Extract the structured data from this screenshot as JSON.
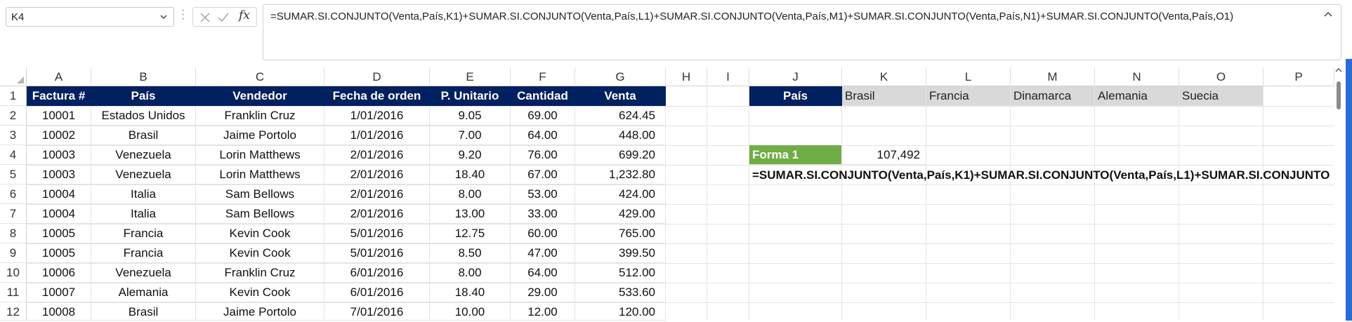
{
  "formula_bar": {
    "name_box": "K4",
    "fx_label": "fx",
    "formula": "=SUMAR.SI.CONJUNTO(Venta,País,K1)+SUMAR.SI.CONJUNTO(Venta,País,L1)+SUMAR.SI.CONJUNTO(Venta,País,M1)+SUMAR.SI.CONJUNTO(Venta,País,N1)+SUMAR.SI.CONJUNTO(Venta,País,O1)"
  },
  "columns": [
    "A",
    "B",
    "C",
    "D",
    "E",
    "F",
    "G",
    "H",
    "I",
    "J",
    "K",
    "L",
    "M",
    "N",
    "O",
    "P"
  ],
  "row_numbers": [
    "1",
    "2",
    "3",
    "4",
    "5",
    "6",
    "7",
    "8",
    "9",
    "10",
    "11",
    "12"
  ],
  "table": {
    "headers": [
      "Factura #",
      "País",
      "Vendedor",
      "Fecha de orden",
      "P. Unitario",
      "Cantidad",
      "Venta"
    ],
    "rows": [
      [
        "10001",
        "Estados Unidos",
        "Franklin Cruz",
        "1/01/2016",
        "9.05",
        "69.00",
        "624.45"
      ],
      [
        "10002",
        "Brasil",
        "Jaime Portolo",
        "1/01/2016",
        "7.00",
        "64.00",
        "448.00"
      ],
      [
        "10003",
        "Venezuela",
        "Lorin Matthews",
        "2/01/2016",
        "9.20",
        "76.00",
        "699.20"
      ],
      [
        "10003",
        "Venezuela",
        "Lorin Matthews",
        "2/01/2016",
        "18.40",
        "67.00",
        "1,232.80"
      ],
      [
        "10004",
        "Italia",
        "Sam Bellows",
        "2/01/2016",
        "8.00",
        "53.00",
        "424.00"
      ],
      [
        "10004",
        "Italia",
        "Sam Bellows",
        "2/01/2016",
        "13.00",
        "33.00",
        "429.00"
      ],
      [
        "10005",
        "Francia",
        "Kevin Cook",
        "5/01/2016",
        "12.75",
        "60.00",
        "765.00"
      ],
      [
        "10005",
        "Francia",
        "Kevin Cook",
        "5/01/2016",
        "8.50",
        "47.00",
        "399.50"
      ],
      [
        "10006",
        "Venezuela",
        "Franklin Cruz",
        "6/01/2016",
        "8.00",
        "64.00",
        "512.00"
      ],
      [
        "10007",
        "Alemania",
        "Kevin Cook",
        "6/01/2016",
        "18.40",
        "29.00",
        "533.60"
      ],
      [
        "10008",
        "Brasil",
        "Jaime Portolo",
        "7/01/2016",
        "10.00",
        "12.00",
        "120.00"
      ]
    ]
  },
  "criteria": {
    "header": "País",
    "countries": [
      "Brasil",
      "Francia",
      "Dinamarca",
      "Alemania",
      "Suecia"
    ]
  },
  "result": {
    "label": "Forma 1",
    "value": "107,492",
    "formula_text": "=SUMAR.SI.CONJUNTO(Venta,País,K1)+SUMAR.SI.CONJUNTO(Venta,País,L1)+SUMAR.SI.CONJUNTO(Venta,País,M1)+SUMAR.SI.CONJUNTO(Venta,País,N1)+SUMAR.SI.CONJUNTO(Venta,País,O1)"
  },
  "colors": {
    "header_fill": "#002060",
    "criteria_fill": "#d9d9d9",
    "label_fill": "#70ad47",
    "scrollbar": "#2a6bd6"
  }
}
